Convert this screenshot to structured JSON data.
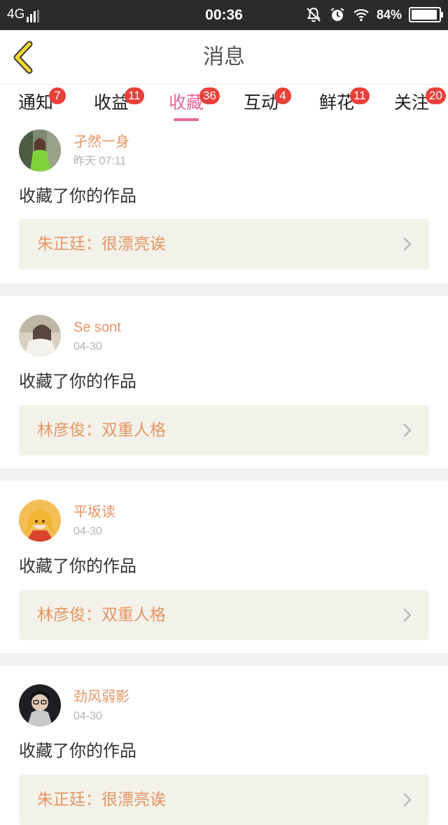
{
  "status_bar": {
    "network": "4G",
    "time": "00:36",
    "battery_percent": "84%",
    "icons": [
      "signal-icon",
      "mute-bell-icon",
      "alarm-icon",
      "wifi-icon",
      "battery-icon"
    ]
  },
  "header": {
    "title": "消息",
    "back_icon": "chevron-left-icon"
  },
  "tabs": [
    {
      "label": "通知",
      "badge": "7"
    },
    {
      "label": "收益",
      "badge": "11"
    },
    {
      "label": "收藏",
      "badge": "36",
      "active": true
    },
    {
      "label": "互动",
      "badge": "4"
    },
    {
      "label": "鲜花",
      "badge": "11"
    },
    {
      "label": "关注",
      "badge": "20"
    }
  ],
  "feed": [
    {
      "user": "孑然一身",
      "time": "昨天 07:11",
      "action": "收藏了你的作品",
      "work": "朱正廷：很漂亮诶"
    },
    {
      "user": "Se sont",
      "time": "04-30",
      "action": "收藏了你的作品",
      "work": "林彦俊：双重人格"
    },
    {
      "user": "平坂读",
      "time": "04-30",
      "action": "收藏了你的作品",
      "work": "林彦俊：双重人格"
    },
    {
      "user": "劲风弱影",
      "time": "04-30",
      "action": "收藏了你的作品",
      "work": "朱正廷：很漂亮诶"
    }
  ],
  "colors": {
    "accent_pink": "#e8679a",
    "badge_red": "#e9403a",
    "name_orange": "#e59565",
    "card_box": "#f3f2ea",
    "back_arrow": "#f0d531"
  }
}
